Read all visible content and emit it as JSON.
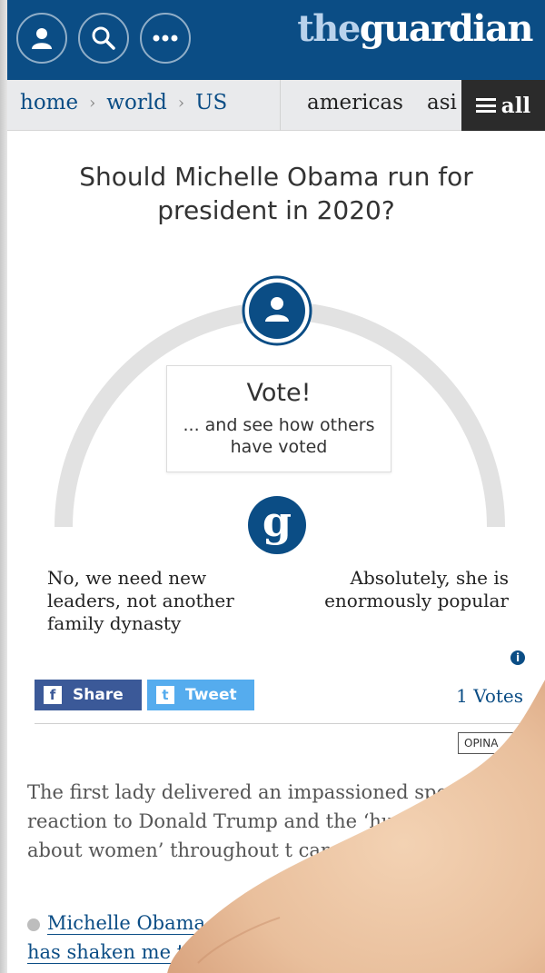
{
  "header": {
    "logo_the": "the",
    "logo_guardian": "guardian",
    "icons": [
      "profile-icon",
      "search-icon",
      "more-icon"
    ]
  },
  "nav": {
    "crumbs": [
      "home",
      "world",
      "US"
    ],
    "sections": [
      "americas",
      "asi"
    ],
    "all_label": "all"
  },
  "poll": {
    "question": "Should Michelle Obama run for president in 2020?",
    "tooltip_title": "Vote!",
    "tooltip_body": "... and see how others have voted",
    "option_left": "No, we need new leaders, not another family dynasty",
    "option_right": "Absolutely, she is enormously popular",
    "info_label": "i"
  },
  "social": {
    "share_label": "Share",
    "tweet_label": "Tweet",
    "votes_label": "1 Votes",
    "opina_label": "OPINA"
  },
  "article": {
    "standfirst": "The first lady delivered an impassioned spee reaction to Donald Trump and the ‘hurtf language about women’ throughout t campaign",
    "related_line1": "Michelle Obama d",
    "related_line2": "has shaken me t"
  },
  "colors": {
    "brand_blue": "#0b4d85",
    "facebook": "#3b5998",
    "twitter": "#55acee",
    "nav_bg": "#e9eaec"
  }
}
